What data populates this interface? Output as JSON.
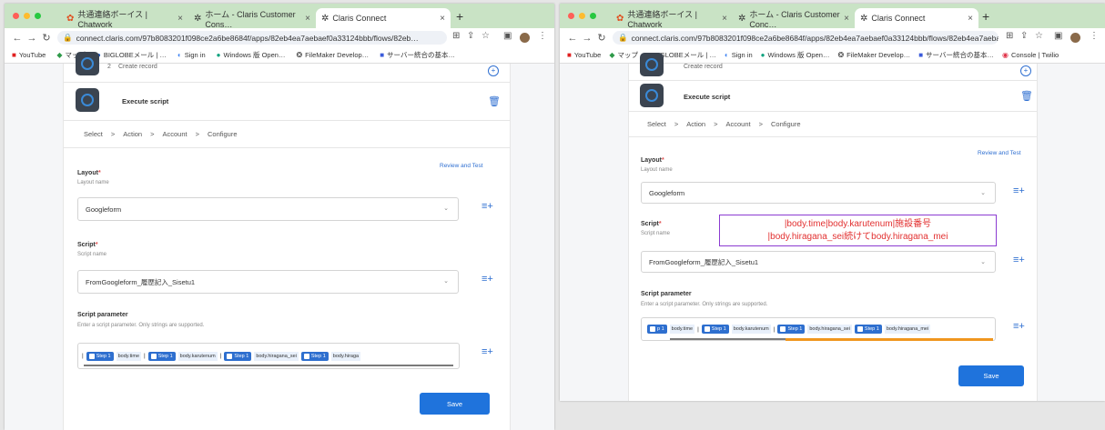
{
  "left": {
    "tabs": [
      {
        "title": "共通連絡ボーイス | Chatwork",
        "icon": "chatwork-icon"
      },
      {
        "title": "ホーム - Claris Customer Cons…",
        "icon": "claris-icon"
      },
      {
        "title": "Claris Connect",
        "icon": "claris-icon"
      }
    ],
    "url": "connect.claris.com/97b8083201f098ce2a6be8684f/apps/82eb4ea7aebaef0a33124bbb/flows/82eb…",
    "bookmarks": [
      {
        "label": "YouTube",
        "icon": "youtube-icon",
        "color": "#e02020"
      },
      {
        "label": "マップ",
        "icon": "maps-icon",
        "color": "#2f9a4a"
      },
      {
        "label": "BIGLOBEメール | …",
        "icon": "biglobe-icon",
        "color": "#1a56c4"
      },
      {
        "label": "Sign in",
        "icon": "sign-in-icon",
        "color": "#4285f4"
      },
      {
        "label": "Windows 版 Open…",
        "icon": "openai-icon",
        "color": "#10a37f"
      },
      {
        "label": "FileMaker Develop…",
        "icon": "filemaker-icon",
        "color": "#333333"
      },
      {
        "label": "サーバー統合の基本…",
        "icon": "doc-icon",
        "color": "#3b5bdb"
      }
    ],
    "prev_step": "Create record",
    "prev_step_num": "2",
    "step_title": "Execute script",
    "breadcrumb": [
      "Select",
      ">",
      "Action",
      ">",
      "Account",
      ">",
      "Configure"
    ],
    "review_link": "Review and Test",
    "layout_label": "Layout",
    "layout_sub": "Layout name",
    "layout_value": "Googleform",
    "script_label": "Script",
    "script_sub": "Script name",
    "script_value": "FromGoogleform_履歴記入_Sisetu1",
    "param_label": "Script parameter",
    "param_sub": "Enter a script parameter. Only strings are supported.",
    "param_items": [
      {
        "kind": "pipe",
        "text": "|"
      },
      {
        "kind": "chip",
        "text": "Step 1"
      },
      {
        "kind": "text",
        "text": "body.time"
      },
      {
        "kind": "pipe",
        "text": "|"
      },
      {
        "kind": "chip",
        "text": "Step 1"
      },
      {
        "kind": "text",
        "text": "body.karutenum"
      },
      {
        "kind": "pipe",
        "text": "|"
      },
      {
        "kind": "chip",
        "text": "Step 1"
      },
      {
        "kind": "text",
        "text": "body.hiragana_sei"
      },
      {
        "kind": "chip",
        "text": "Step 1"
      },
      {
        "kind": "text",
        "text": "body.hiraga"
      }
    ],
    "save_label": "Save"
  },
  "right": {
    "tabs": [
      {
        "title": "共通連絡ボーイス | Chatwork",
        "icon": "chatwork-icon"
      },
      {
        "title": "ホーム - Claris Customer Conc…",
        "icon": "claris-icon"
      },
      {
        "title": "Claris Connect",
        "icon": "claris-icon"
      }
    ],
    "url": "connect.claris.com/97b8083201f098ce2a6be8684f/apps/82eb4ea7aebaef0a33124bbb/flows/82eb4ea7aebaef…",
    "bookmarks": [
      {
        "label": "YouTube",
        "icon": "youtube-icon",
        "color": "#e02020"
      },
      {
        "label": "マップ",
        "icon": "maps-icon",
        "color": "#2f9a4a"
      },
      {
        "label": "BIGLOBEメール | …",
        "icon": "biglobe-icon",
        "color": "#1a56c4"
      },
      {
        "label": "Sign in",
        "icon": "sign-in-icon",
        "color": "#4285f4"
      },
      {
        "label": "Windows 版 Open…",
        "icon": "openai-icon",
        "color": "#10a37f"
      },
      {
        "label": "FileMaker Develop…",
        "icon": "filemaker-icon",
        "color": "#333333"
      },
      {
        "label": "サーバー統合の基本…",
        "icon": "doc-icon",
        "color": "#3b5bdb"
      },
      {
        "label": "Console | Twilio",
        "icon": "twilio-icon",
        "color": "#e0344a"
      }
    ],
    "prev_step": "Create record",
    "step_title": "Execute script",
    "breadcrumb": [
      "Select",
      ">",
      "Action",
      ">",
      "Account",
      ">",
      "Configure"
    ],
    "review_link": "Review and Test",
    "layout_label": "Layout",
    "layout_sub": "Layout name",
    "layout_value": "Googleform",
    "script_label": "Script",
    "script_sub": "Script name",
    "script_value": "FromGoogleform_履歴記入_Sisetu1",
    "param_label": "Script parameter",
    "param_sub": "Enter a script parameter. Only strings are supported.",
    "param_items": [
      {
        "kind": "chip",
        "text": "p 1"
      },
      {
        "kind": "text",
        "text": "body.time"
      },
      {
        "kind": "pipe",
        "text": "|"
      },
      {
        "kind": "chip",
        "text": "Step 1"
      },
      {
        "kind": "text",
        "text": "body.karutenum"
      },
      {
        "kind": "pipe",
        "text": "|"
      },
      {
        "kind": "chip",
        "text": "Step 1"
      },
      {
        "kind": "text",
        "text": "body.hiragana_sei"
      },
      {
        "kind": "chip",
        "text": "Step 1"
      },
      {
        "kind": "text",
        "text": "body.hiragana_mei"
      }
    ],
    "annotation_line1": "|body.time|body.karutenum|施設番号",
    "annotation_line2": "|body.hiragana_sei続けてbody.hiragana_mei",
    "save_label": "Save"
  },
  "colors": {
    "accent": "#1f73dc",
    "tabbar": "#c9e3c5",
    "annotation_text": "#e23030",
    "annotation_border": "#8b3bd1",
    "underline_gray": "#7a7a7a",
    "underline_orange": "#f0961e"
  }
}
